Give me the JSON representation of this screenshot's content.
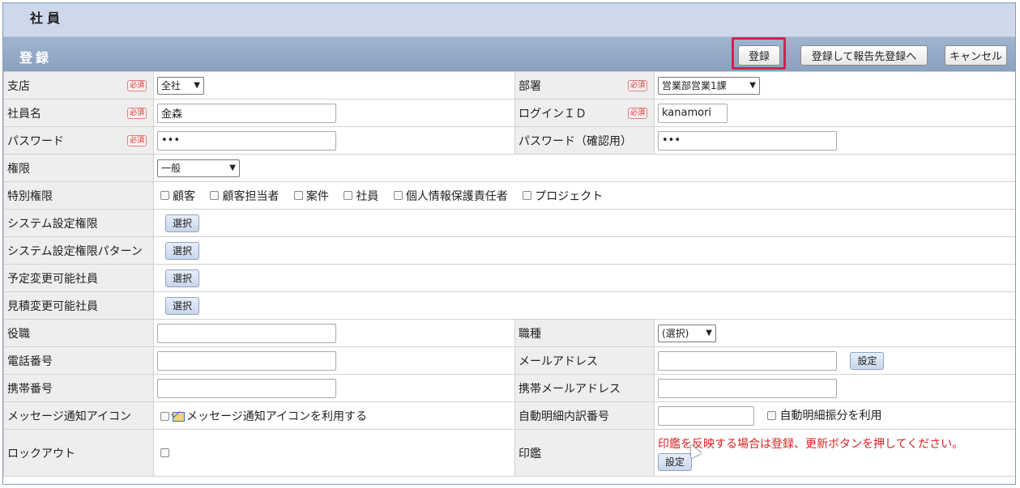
{
  "title": "社員",
  "section": "登録",
  "buttons": {
    "register": "登録",
    "register_report": "登録して報告先登録へ",
    "cancel": "キャンセル"
  },
  "required_badge": "必須",
  "fields": {
    "branch": {
      "label": "支店",
      "value": "全社"
    },
    "department": {
      "label": "部署",
      "value": "営業部営業1課"
    },
    "employee_name": {
      "label": "社員名",
      "value": "金森"
    },
    "login_id": {
      "label": "ログインＩＤ",
      "value": "kanamori"
    },
    "password": {
      "label": "パスワード",
      "value": "•••"
    },
    "password_confirm": {
      "label": "パスワード（確認用）",
      "value": "•••"
    },
    "authority": {
      "label": "権限",
      "value": "一般"
    },
    "special_authority": {
      "label": "特別権限",
      "options": [
        "顧客",
        "顧客担当者",
        "案件",
        "社員",
        "個人情報保護責任者",
        "プロジェクト"
      ]
    },
    "system_setting_authority": {
      "label": "システム設定権限",
      "button": "選択"
    },
    "system_setting_pattern": {
      "label": "システム設定権限パターン",
      "button": "選択"
    },
    "schedule_editable": {
      "label": "予定変更可能社員",
      "button": "選択"
    },
    "estimate_editable": {
      "label": "見積変更可能社員",
      "button": "選択"
    },
    "position": {
      "label": "役職",
      "value": ""
    },
    "job_type": {
      "label": "職種",
      "value": "(選択)"
    },
    "phone": {
      "label": "電話番号",
      "value": ""
    },
    "email": {
      "label": "メールアドレス",
      "value": "",
      "button": "設定"
    },
    "mobile": {
      "label": "携帯番号",
      "value": ""
    },
    "mobile_email": {
      "label": "携帯メールアドレス",
      "value": ""
    },
    "message_icon": {
      "label": "メッセージ通知アイコン",
      "option": "メッセージ通知アイコンを利用する"
    },
    "auto_detail_no": {
      "label": "自動明細内訳番号",
      "value": "",
      "option": "自動明細振分を利用"
    },
    "lockout": {
      "label": "ロックアウト"
    },
    "seal": {
      "label": "印鑑",
      "note": "印鑑を反映する場合は登録、更新ボタンを押してください。",
      "button": "設定"
    }
  }
}
